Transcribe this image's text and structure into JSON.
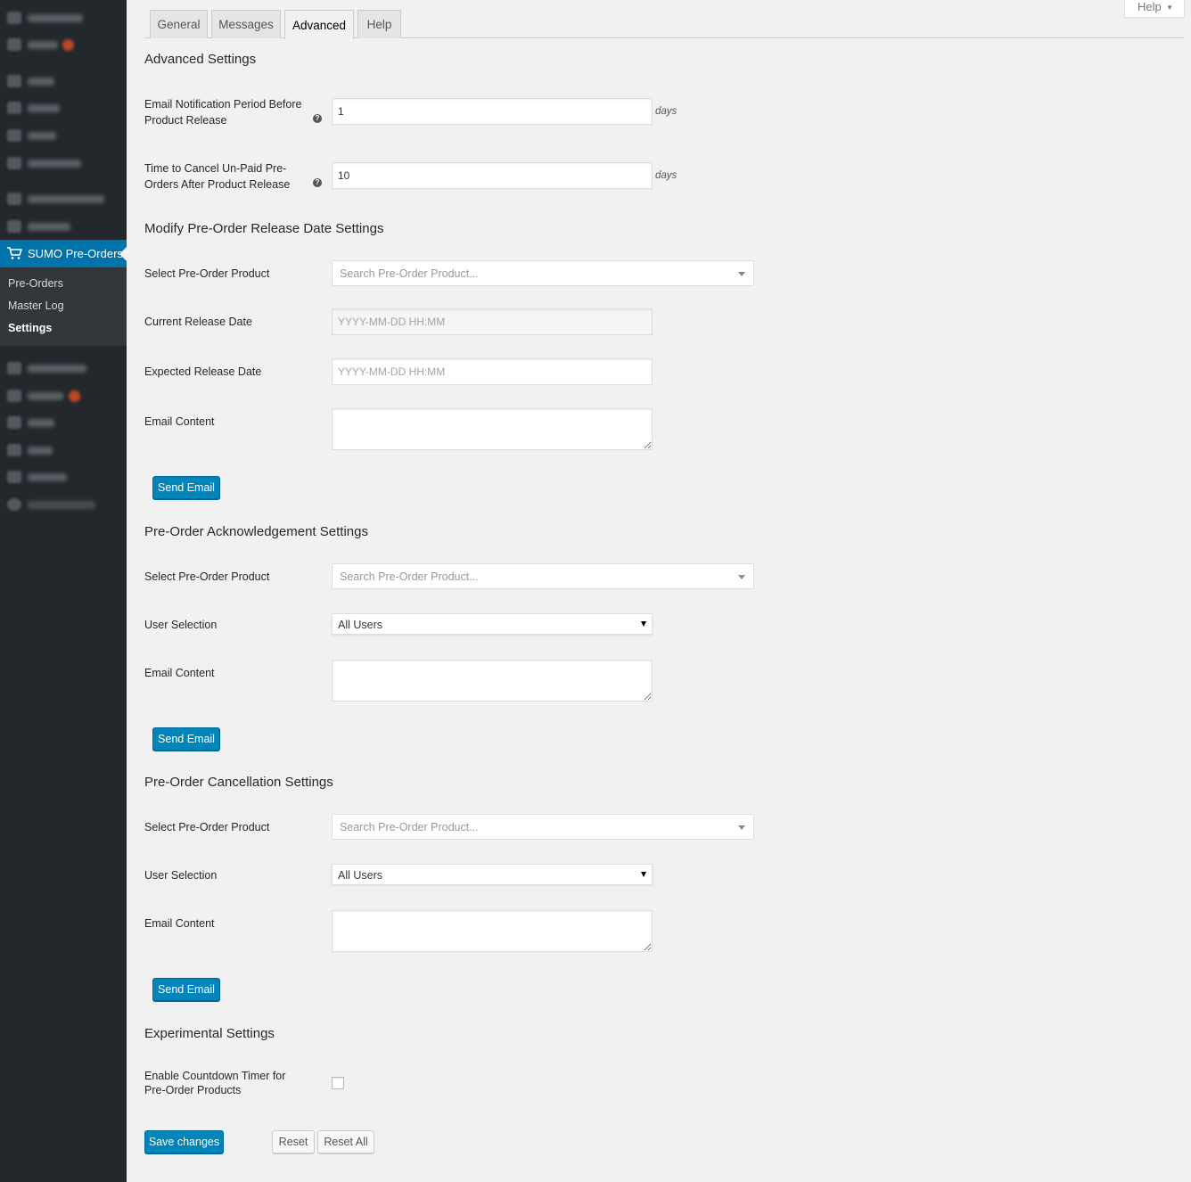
{
  "sidebar": {
    "active_label": "SUMO Pre-Orders",
    "submenu": [
      {
        "label": "Pre-Orders",
        "current": false
      },
      {
        "label": "Master Log",
        "current": false
      },
      {
        "label": "Settings",
        "current": true
      }
    ]
  },
  "help_tab": {
    "label": "Help"
  },
  "tabs": [
    {
      "label": "General",
      "active": false
    },
    {
      "label": "Messages",
      "active": false
    },
    {
      "label": "Advanced",
      "active": true
    },
    {
      "label": "Help",
      "active": false
    }
  ],
  "advanced": {
    "title": "Advanced Settings",
    "notify_label": "Email Notification Period Before Product Release",
    "notify_value": "1",
    "notify_suffix": "days",
    "cancel_label": "Time to Cancel Un-Paid Pre-Orders After Product Release",
    "cancel_value": "10",
    "cancel_suffix": "days"
  },
  "modify": {
    "title": "Modify Pre-Order Release Date Settings",
    "product_label": "Select Pre-Order Product",
    "product_placeholder": "Search Pre-Order Product...",
    "current_label": "Current Release Date",
    "current_placeholder": "YYYY-MM-DD HH:MM",
    "expected_label": "Expected Release Date",
    "expected_placeholder": "YYYY-MM-DD HH:MM",
    "email_label": "Email Content",
    "send_label": "Send Email"
  },
  "ack": {
    "title": "Pre-Order Acknowledgement Settings",
    "product_label": "Select Pre-Order Product",
    "product_placeholder": "Search Pre-Order Product...",
    "user_label": "User Selection",
    "user_value": "All Users",
    "email_label": "Email Content",
    "send_label": "Send Email"
  },
  "cancel": {
    "title": "Pre-Order Cancellation Settings",
    "product_label": "Select Pre-Order Product",
    "product_placeholder": "Search Pre-Order Product...",
    "user_label": "User Selection",
    "user_value": "All Users",
    "email_label": "Email Content",
    "send_label": "Send Email"
  },
  "experimental": {
    "title": "Experimental Settings",
    "countdown_label": "Enable Countdown Timer for Pre-Order Products",
    "countdown_checked": false
  },
  "footer": {
    "save_label": "Save changes",
    "reset_label": "Reset",
    "reset_all_label": "Reset All"
  },
  "colors": {
    "sidebar_bg": "#23282d",
    "accent": "#0073aa",
    "primary_button": "#0085ba",
    "page_bg": "#f1f1f1"
  }
}
